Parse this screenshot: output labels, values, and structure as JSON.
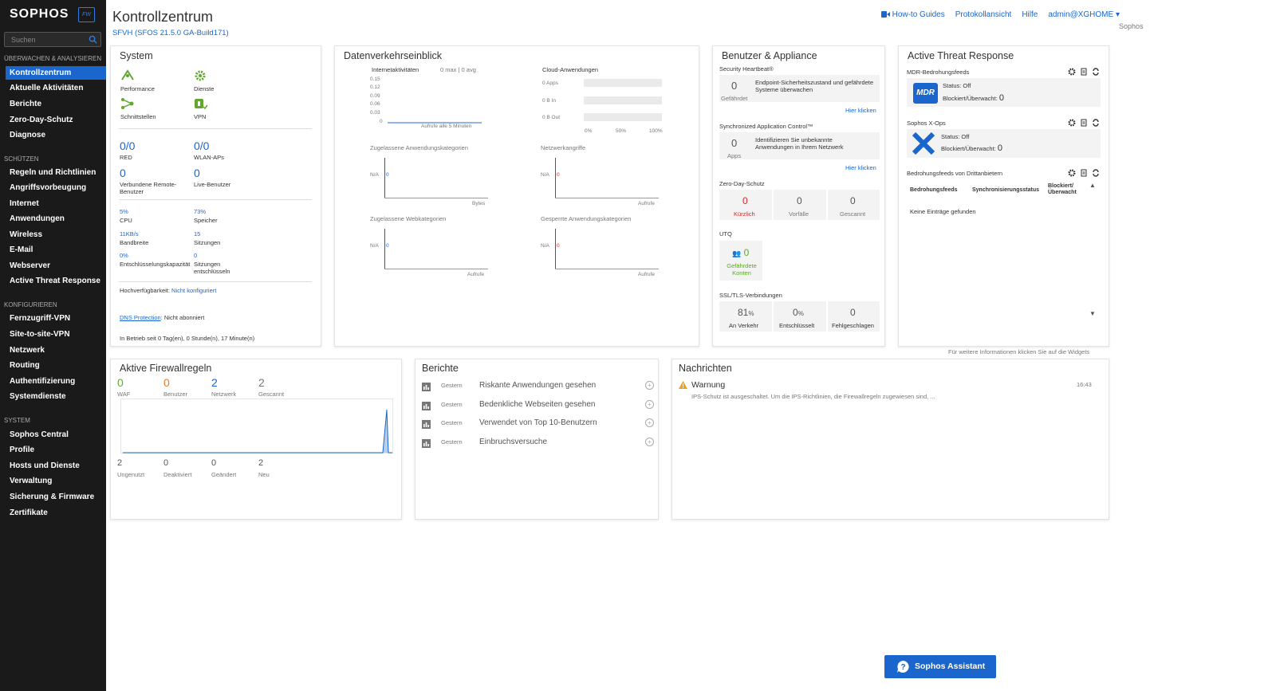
{
  "brand": {
    "logo": "SOPHOS",
    "badge": "FW"
  },
  "sidebar": {
    "search_placeholder": "Suchen",
    "sections": [
      "ÜBERWACHEN & ANALYSIEREN",
      "SCHÜTZEN",
      "KONFIGURIEREN",
      "SYSTEM"
    ],
    "items": [
      "Kontrollzentrum",
      "Aktuelle Aktivitäten",
      "Berichte",
      "Zero-Day-Schutz",
      "Diagnose",
      "Regeln und Richtlinien",
      "Angriffsvorbeugung",
      "Internet",
      "Anwendungen",
      "Wireless",
      "E-Mail",
      "Webserver",
      "Active Threat Response",
      "Fernzugriff-VPN",
      "Site-to-site-VPN",
      "Netzwerk",
      "Routing",
      "Authentifizierung",
      "Systemdienste",
      "Sophos Central",
      "Profile",
      "Hosts und Dienste",
      "Verwaltung",
      "Sicherung & Firmware",
      "Zertifikate"
    ]
  },
  "header": {
    "title": "Kontrollzentrum",
    "subtitle": "SFVH (SFOS 21.5.0 GA-Build171)",
    "links": [
      "How-to Guides",
      "Protokollansicht",
      "Hilfe",
      "admin@XGHOME"
    ],
    "org": "Sophos"
  },
  "system": {
    "title": "System",
    "icons": [
      "Performance",
      "Dienste",
      "Schnittstellen",
      "VPN"
    ],
    "stats": [
      {
        "value": "0/0",
        "label": "RED"
      },
      {
        "value": "0/0",
        "label": "WLAN-APs"
      },
      {
        "value": "0",
        "label": "Verbundene Remote-Benutzer"
      },
      {
        "value": "0",
        "label": "Live-Benutzer"
      }
    ],
    "metrics": [
      {
        "value": "5%",
        "label": "CPU"
      },
      {
        "value": "73%",
        "label": "Speicher"
      },
      {
        "value": "11KB/s",
        "label": "Bandbreite"
      },
      {
        "value": "15",
        "label": "Sitzungen"
      },
      {
        "value": "0%",
        "label": "Entschlüsselungskapazität"
      },
      {
        "value": "0",
        "label": "Sitzungen entschlüsseln"
      }
    ],
    "ha_label": "Hochverfügbarkeit:",
    "ha_value": "Nicht konfiguriert",
    "dns_label": "DNS Protection",
    "dns_value": ": Nicht abonniert",
    "uptime": "In Betrieb seit 0 Tag(en), 0 Stunde(n), 17 Minute(n)"
  },
  "traffic": {
    "title": "Datenverkehrseinblick",
    "internet": {
      "label": "Internetaktivitäten",
      "stats": "0 max | 0 avg",
      "yticks": [
        "0.15",
        "0.12",
        "0.09",
        "0.06",
        "0.03",
        "0"
      ],
      "xlabel": "Aufrufe alle 5 Minuten"
    },
    "cloud": {
      "label": "Cloud-Anwendungen",
      "rows": [
        "0 Apps",
        "0 B In",
        "0 B Out"
      ],
      "xticks": [
        "0%",
        "50%",
        "100%"
      ]
    },
    "charts": [
      {
        "label": "Zugelassene Anwendungskategorien",
        "na": "N/A",
        "zero": "0",
        "unit": "Bytes"
      },
      {
        "label": "Netzwerkangriffe",
        "na": "N/A",
        "zero": "0",
        "unit": "Aufrufe"
      },
      {
        "label": "Zugelassene Webkategorien",
        "na": "N/A",
        "zero": "0",
        "unit": "Aufrufe"
      },
      {
        "label": "Gesperrte Anwendungskategorien",
        "na": "N/A",
        "zero": "0",
        "unit": "Aufrufe"
      }
    ]
  },
  "users": {
    "title": "Benutzer & Appliance",
    "heartbeat": {
      "label": "Security Heartbeat®",
      "value": "0",
      "unit": "Gefährdet",
      "desc": "Endpoint-Sicherheitszustand und gefährdete Systeme überwachen",
      "link": "Hier klicken"
    },
    "sac": {
      "label": "Synchronized Application Control™",
      "value": "0",
      "unit": "Apps",
      "desc": "Identifizieren Sie unbekannte Anwendungen in Ihrem Netzwerk",
      "link": "Hier klicken"
    },
    "zeroday": {
      "label": "Zero-Day-Schutz",
      "cells": [
        {
          "value": "0",
          "label": "Kürzlich"
        },
        {
          "value": "0",
          "label": "Vorfälle"
        },
        {
          "value": "0",
          "label": "Gescannt"
        }
      ]
    },
    "utq": {
      "label": "UTQ",
      "value": "0",
      "unit": "Gefährdete Konten"
    },
    "ssl": {
      "label": "SSL/TLS-Verbindungen",
      "cells": [
        {
          "value": "81",
          "pct": "%",
          "label": "An Verkehr"
        },
        {
          "value": "0",
          "pct": "%",
          "label": "Entschlüsselt"
        },
        {
          "value": "0",
          "pct": "",
          "label": "Fehlgeschlagen"
        }
      ]
    }
  },
  "atr": {
    "title": "Active Threat Response",
    "mdr": {
      "label": "MDR-Bedrohungsfeeds",
      "logo": "MDR",
      "status": "Status:  Off",
      "blocked": "Blockiert/Überwacht:",
      "count": "0"
    },
    "xops": {
      "label": "Sophos X-Ops",
      "status": "Status:  Off",
      "blocked": "Blockiert/Überwacht:",
      "count": "0"
    },
    "third": {
      "label": "Bedrohungsfeeds von Drittanbietern",
      "cols": [
        "Bedrohungsfeeds",
        "Synchronisierungsstatus",
        "Blockiert/ Überwacht"
      ],
      "empty": "Keine Einträge gefunden"
    }
  },
  "hint": "Für weitere Informationen klicken Sie auf die Widgets",
  "firewall": {
    "title": "Aktive Firewallregeln",
    "top": [
      {
        "value": "0",
        "label": "WAF",
        "color": "#5fa82d"
      },
      {
        "value": "0",
        "label": "Benutzer",
        "color": "#e87a2e"
      },
      {
        "value": "2",
        "label": "Netzwerk",
        "color": "#1a66cc"
      },
      {
        "value": "2",
        "label": "Gescannt",
        "color": "#777777"
      }
    ],
    "bottom": [
      {
        "value": "2",
        "label": "Ungenutzt"
      },
      {
        "value": "0",
        "label": "Deaktiviert"
      },
      {
        "value": "0",
        "label": "Geändert"
      },
      {
        "value": "2",
        "label": "Neu"
      }
    ]
  },
  "reports": {
    "title": "Berichte",
    "rows": [
      {
        "when": "Gestern",
        "name": "Riskante Anwendungen gesehen"
      },
      {
        "when": "Gestern",
        "name": "Bedenkliche Webseiten gesehen"
      },
      {
        "when": "Gestern",
        "name": "Verwendet von Top 10-Benutzern"
      },
      {
        "when": "Gestern",
        "name": "Einbruchsversuche"
      }
    ]
  },
  "messages": {
    "title": "Nachrichten",
    "items": [
      {
        "type": "Warnung",
        "time": "16:43",
        "text": "IPS-Schutz ist ausgeschaltet. Um die IPS-Richtlinien, die Firewallregeln zugewiesen sind, ..."
      }
    ]
  },
  "assistant": {
    "label": "Sophos Assistant"
  },
  "colors": {
    "accent": "#1a66cc",
    "sidebar": "#1a1a1a",
    "danger": "#d4252a",
    "success": "#5fa82d"
  }
}
